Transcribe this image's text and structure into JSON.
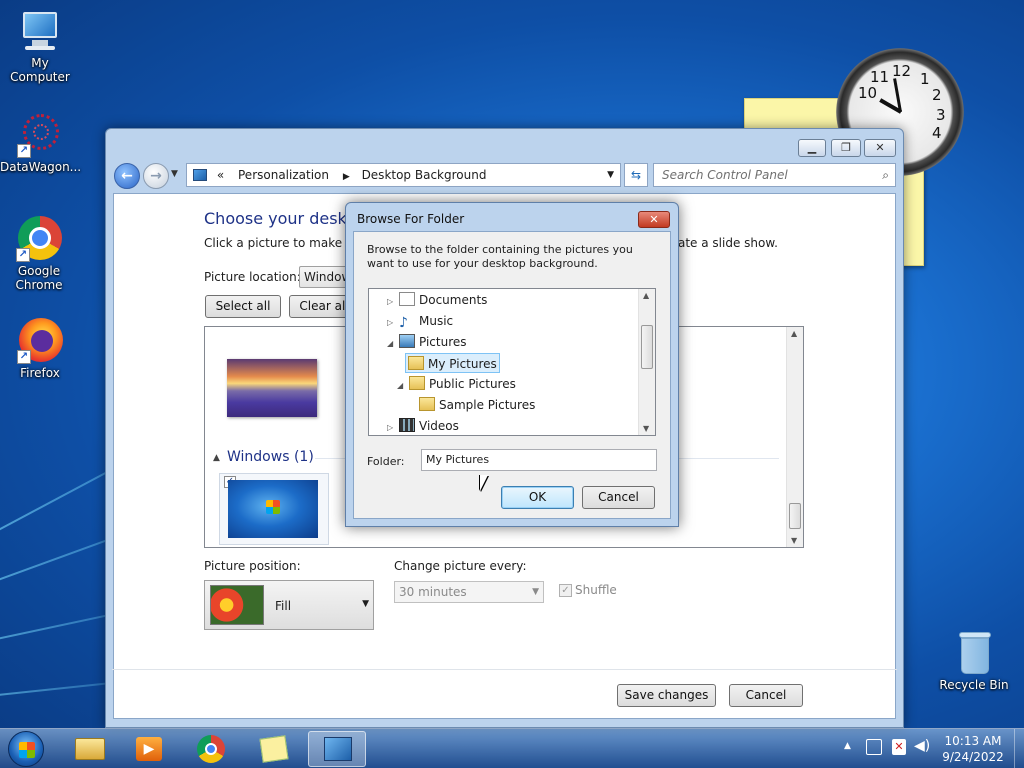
{
  "desktop": {
    "icons": [
      {
        "label": "My Computer"
      },
      {
        "label": "DataWagon..."
      },
      {
        "label": "Google Chrome"
      },
      {
        "label": "Firefox"
      },
      {
        "label": "Recycle Bin"
      }
    ],
    "clock_numbers": [
      "12",
      "1",
      "2",
      "3",
      "4",
      "10",
      "11"
    ]
  },
  "window": {
    "address": {
      "prefix": "«",
      "crumbs": [
        "Personalization",
        "Desktop Background"
      ]
    },
    "search_placeholder": "Search Control Panel",
    "heading": "Choose your desktop",
    "subtext_left": "Click a picture to make it y",
    "subtext_right": "ate a slide show.",
    "picture_location_label": "Picture location:",
    "picture_location_value": "Window",
    "select_all": "Select all",
    "clear_all": "Clear all",
    "group_label": "Windows (1)",
    "picture_position_label": "Picture position:",
    "picture_position_value": "Fill",
    "change_picture_label": "Change picture every:",
    "change_picture_value": "30 minutes",
    "shuffle_label": "Shuffle",
    "save_changes": "Save changes",
    "cancel": "Cancel"
  },
  "dialog": {
    "title": "Browse For Folder",
    "description": "Browse to the folder containing the pictures you want to use for your desktop background.",
    "tree": [
      {
        "label": "Documents"
      },
      {
        "label": "Music"
      },
      {
        "label": "Pictures"
      },
      {
        "label": "My Pictures"
      },
      {
        "label": "Public Pictures"
      },
      {
        "label": "Sample Pictures"
      },
      {
        "label": "Videos"
      }
    ],
    "folder_label": "Folder:",
    "folder_value": "My Pictures",
    "ok": "OK",
    "cancel": "Cancel"
  },
  "tray": {
    "time": "10:13 AM",
    "date": "9/24/2022"
  }
}
